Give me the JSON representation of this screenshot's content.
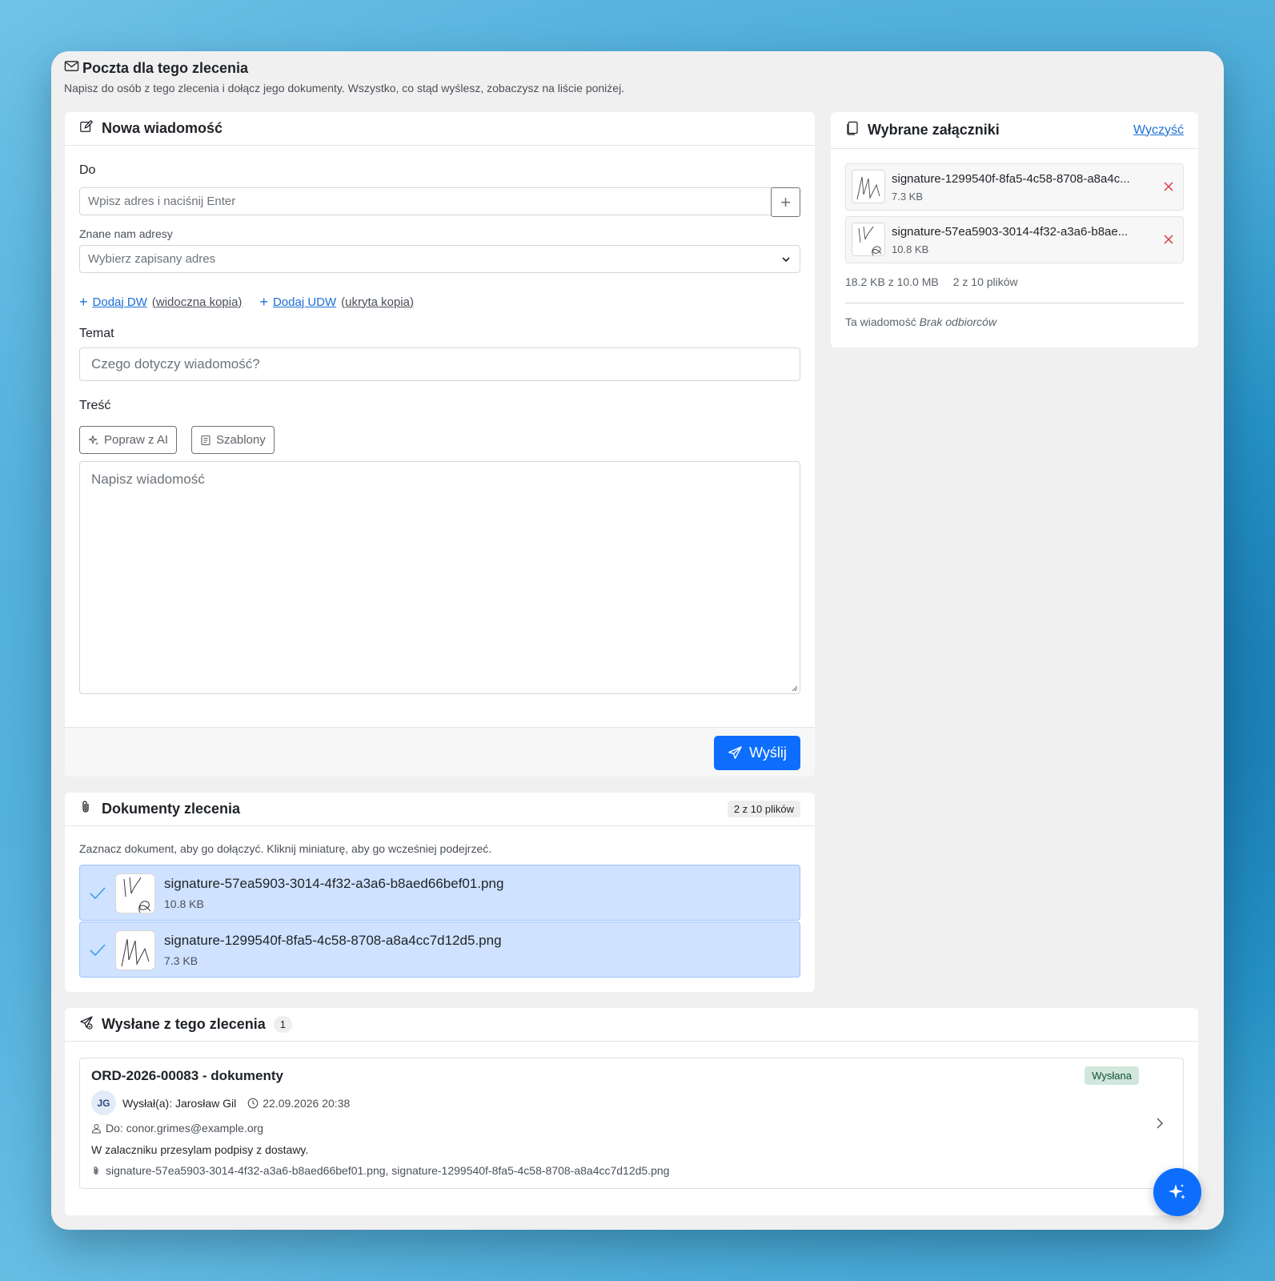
{
  "window": {
    "title": "Poczta dla tego zlecenia",
    "subtitle": "Napisz do osób z tego zlecenia i dołącz jego dokumenty. Wszystko, co stąd wyślesz, zobaczysz na liście poniżej."
  },
  "compose": {
    "title": "Nowa wiadomość",
    "to_label": "Do",
    "to_placeholder": "Wpisz adres i naciśnij Enter",
    "add_label": "+",
    "known_label": "Znane nam adresy",
    "known_placeholder": "Wybierz zapisany adres",
    "cc_strong": "Dodaj DW",
    "cc_rest": "(widoczna kopia)",
    "bcc_strong": "Dodaj UDW",
    "bcc_rest": "(ukryta kopia)",
    "subject_label": "Temat",
    "subject_placeholder": "Czego dotyczy wiadomość?",
    "body_label": "Treść",
    "ai_button": "Popraw z AI",
    "templates_button": "Szablony",
    "body_placeholder": "Napisz wiadomość",
    "send_button": "Wyślij"
  },
  "attachments": {
    "title": "Wybrane załączniki",
    "clear_label": "Wyczyść",
    "items": [
      {
        "name": "signature-1299540f-8fa5-4c58-8708-a8a4c...",
        "size": "7.3 KB"
      },
      {
        "name": "signature-57ea5903-3014-4f32-a3a6-b8ae...",
        "size": "10.8 KB"
      }
    ],
    "total_size": "18.2 KB z 10.0 MB",
    "file_count": "2 z 10 plików",
    "message_label": "Ta wiadomość",
    "message_status": "Brak odbiorców"
  },
  "documents": {
    "title": "Dokumenty zlecenia",
    "count_badge": "2 z 10 plików",
    "hint": "Zaznacz dokument, aby go dołączyć. Kliknij miniaturę, aby go wcześniej podejrzeć.",
    "items": [
      {
        "name": "signature-57ea5903-3014-4f32-a3a6-b8aed66bef01.png",
        "size": "10.8 KB"
      },
      {
        "name": "signature-1299540f-8fa5-4c58-8708-a8a4cc7d12d5.png",
        "size": "7.3 KB"
      }
    ]
  },
  "sent": {
    "title": "Wysłane z tego zlecenia",
    "count": "1",
    "items": [
      {
        "subject": "ORD-2026-00083 - dokumenty",
        "status": "Wysłana",
        "initials": "JG",
        "sender": "Wysłał(a): Jarosław Gil",
        "datetime": "22.09.2026 20:38",
        "to": "Do: conor.grimes@example.org",
        "body": "W zalaczniku przesylam podpisy z dostawy.",
        "files": "signature-57ea5903-3014-4f32-a3a6-b8aed66bef01.png, signature-1299540f-8fa5-4c58-8708-a8a4cc7d12d5.png"
      }
    ]
  },
  "colors": {
    "accent": "#0d6efd",
    "selected_row": "#cfe2ff",
    "success_badge": "#d1e7dd",
    "danger": "#dc3545"
  },
  "icons": {
    "window": "envelope-icon",
    "compose": "pencil-square-icon",
    "attachments": "files-icon",
    "documents": "paperclip-icon",
    "sent": "send-check-icon",
    "fab": "sparkles-icon"
  }
}
